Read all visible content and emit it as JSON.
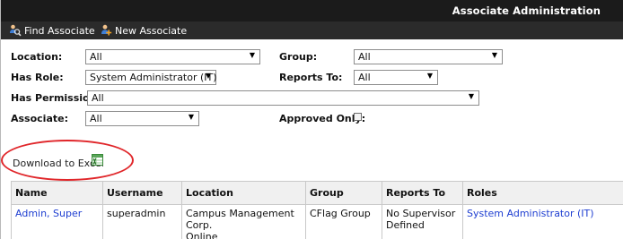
{
  "header": {
    "title": "Associate Administration"
  },
  "toolbar": {
    "find_label": "Find Associate",
    "new_label": "New Associate"
  },
  "filters": {
    "location_label": "Location:",
    "location_value": "All",
    "group_label": "Group:",
    "group_value": "All",
    "has_role_label": "Has Role:",
    "has_role_value": "System Administrator (IT)",
    "reports_to_label": "Reports To:",
    "reports_to_value": "All",
    "has_permission_label": "Has Permission:",
    "has_permission_value": "All",
    "associate_label": "Associate:",
    "associate_value": "All",
    "approved_only_label": "Approved Only:",
    "approved_only_checked": false
  },
  "download": {
    "label": "Download to Excel"
  },
  "table": {
    "headers": [
      "Name",
      "Username",
      "Location",
      "Group",
      "Reports To",
      "Roles"
    ],
    "rows": [
      {
        "name": "Admin, Super",
        "username": "superadmin",
        "location_line1": "Campus Management Corp.",
        "location_line2": "Online",
        "group": "CFlag Group",
        "reports_to_line1": "No Supervisor",
        "reports_to_line2": "Defined",
        "roles": "System Administrator (IT)"
      }
    ]
  },
  "colors": {
    "titlebar_bg": "#1b1b1b",
    "toolbar_bg": "#2b2b2b",
    "link": "#1f3fd1",
    "highlight": "#e0262a"
  }
}
